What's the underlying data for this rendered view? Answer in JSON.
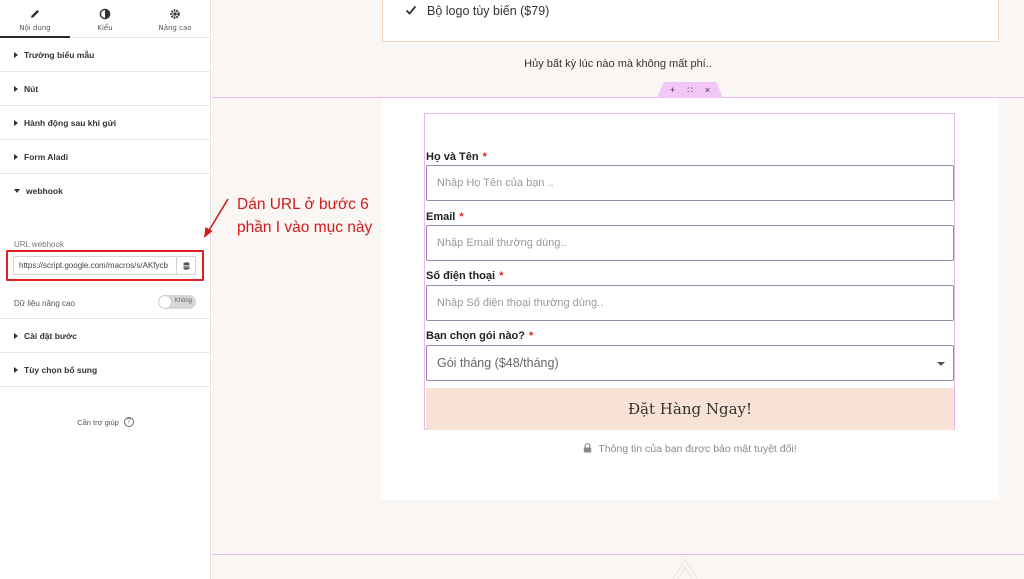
{
  "panel": {
    "tabs": [
      {
        "label": "Nội dung",
        "icon": "pencil-icon"
      },
      {
        "label": "Kiểu",
        "icon": "contrast-circle-icon"
      },
      {
        "label": "Nâng cao",
        "icon": "gear-icon"
      }
    ],
    "sections": [
      {
        "label": "Trường biểu mẫu",
        "expanded": false
      },
      {
        "label": "Nút",
        "expanded": false
      },
      {
        "label": "Hành động sau khi gửi",
        "expanded": false
      },
      {
        "label": "Form Aladi",
        "expanded": false
      },
      {
        "label": "webhook",
        "expanded": true
      },
      {
        "label": "Cài đặt bước",
        "expanded": false
      },
      {
        "label": "Tùy chọn bổ sung",
        "expanded": false
      }
    ],
    "webhook": {
      "url_label": "URL webhook",
      "url_value": "https://script.google.com/macros/s/AKfycb",
      "advanced_label": "Dữ liệu nâng cao",
      "advanced_toggle": "Không"
    },
    "help_label": "Cần trợ giúp"
  },
  "annotation": {
    "line1": "Dán URL ở bước 6",
    "line2": "phần I vào mục này",
    "color": "#d01c1c"
  },
  "canvas": {
    "top_feature": "Bộ logo tùy biến ($79)",
    "cancel_note": "Hủy bất kỳ lúc nào mà không mất phí..",
    "section_handle": {
      "add": "+",
      "move": "∷",
      "close": "×"
    },
    "form": {
      "fields": [
        {
          "label": "Họ và Tên",
          "placeholder": "Nhập Họ Tên của bạn .."
        },
        {
          "label": "Email",
          "placeholder": "Nhập Email thường dùng.."
        },
        {
          "label": "Số điện thoại",
          "placeholder": "Nhập Số điện thoại thường dùng.."
        }
      ],
      "required_mark": "*",
      "plan_label": "Bạn chọn gói nào?",
      "plan_value": "Gói tháng ($48/tháng)",
      "submit_label": "Đặt Hàng Ngay!",
      "secure_note": "Thông tin của bạn được bảo mật tuyệt đối!"
    }
  },
  "colors": {
    "accent_button": "#f8e2d5",
    "section_outline": "#e9b8ee",
    "required": "#e02020"
  }
}
